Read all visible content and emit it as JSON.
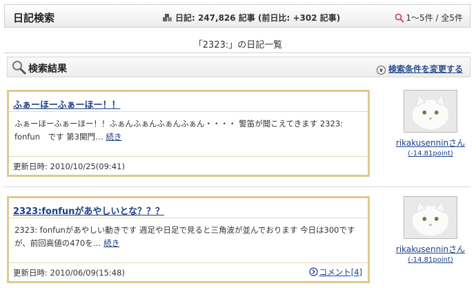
{
  "header": {
    "title": "日記検索",
    "stats_text": "日記: 247,826 記事 (前日比: +302 記事)",
    "range_text": "1〜5件 / 全5件"
  },
  "list_title": "「2323:」の日記一覧",
  "results_bar": {
    "label": "検索結果",
    "change_condition": "検索条件を変更する"
  },
  "entries": [
    {
      "title": "ふぁーほーふぁーほー！！",
      "body": "ふぁーほーふぁーほー！！ふぁんふぁんふぁんふぁん・・・・ 警笛が聞こえてきます 2323: fonfun　です 第3関門…",
      "more": "続き",
      "updated": "更新日時: 2010/10/25(09:41)",
      "comment": "",
      "user": {
        "name": "rikakusenninさん",
        "point": "(-14.81point)"
      }
    },
    {
      "title": "2323:fonfunがあやしいとな？？？",
      "body": "2323: fonfunがあやしい動きです 週足や日足で見ると三角波が並んでおります 今日は300ですが、前回高値の470を…",
      "more": "続き",
      "updated": "更新日時: 2010/06/09(15:48)",
      "comment": "コメント[4]",
      "user": {
        "name": "rikakusenninさん",
        "point": "(-14.81point)"
      }
    }
  ],
  "colors": {
    "entry_border": "#e0c98e",
    "link": "#1a3e8a",
    "search_icon": "#d9436f"
  },
  "icons": {
    "stats": "blocks-icon",
    "range": "search-icon",
    "results": "magnifier-icon",
    "change": "circle-chevron-down-icon",
    "comment": "circle-arrow-right-icon"
  }
}
